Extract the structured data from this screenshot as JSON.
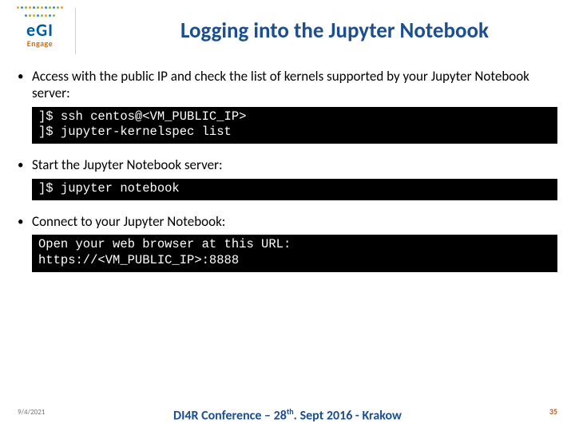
{
  "logo": {
    "main": "eGI",
    "sub": "Engage"
  },
  "title": "Logging into the Jupyter Notebook",
  "bullets": {
    "b1": "Access with the public IP and check the list of kernels supported by your Jupyter Notebook server:",
    "b2": "Start the Jupyter Notebook server:",
    "b3": "Connect to your Jupyter Notebook:"
  },
  "terminals": {
    "t1": "]$ ssh centos@<VM_PUBLIC_IP>\n]$ jupyter-kernelspec list",
    "t2": "]$ jupyter notebook",
    "t3": "Open your web browser at this URL:\nhttps://<VM_PUBLIC_IP>:8888"
  },
  "footer": {
    "date": "9/4/2021",
    "center_prefix": "DI4R Conference – 28",
    "center_suffix": ". Sept 2016 - Krakow",
    "page": "35"
  }
}
